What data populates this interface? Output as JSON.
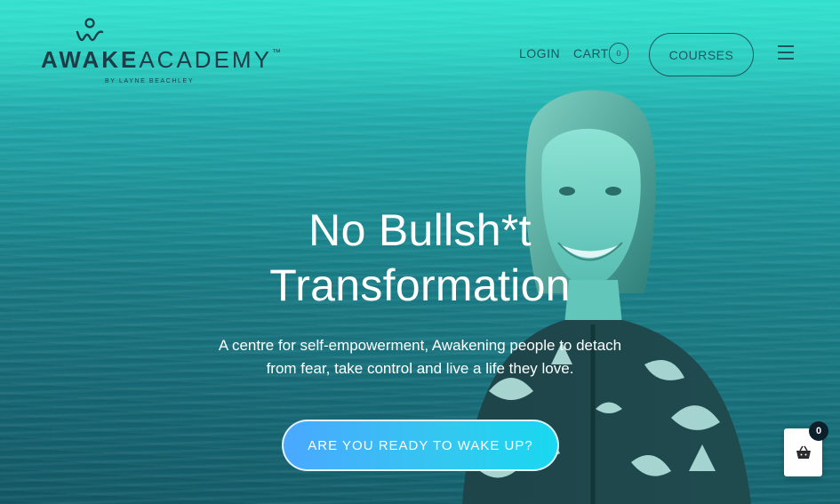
{
  "logo": {
    "word_bold": "AWAKE",
    "word_light": "ACADEMY",
    "tm": "™",
    "sub": "BY LAYNE BEACHLEY"
  },
  "nav": {
    "login": "LOGIN",
    "cart": "CART",
    "cart_count": "0",
    "courses": "COURSES"
  },
  "hero": {
    "title_line1": "No Bullsh*t",
    "title_line2": "Transformation",
    "subtitle_line1": "A centre for self-empowerment, Awakening people to detach",
    "subtitle_line2": "from fear, take control and live a life they love.",
    "cta": "ARE YOU READY TO WAKE UP?"
  },
  "basket": {
    "count": "0",
    "icon": "basket-icon"
  },
  "colors": {
    "accent": "#38e3cf",
    "cta_start": "#4aa8ff",
    "cta_end": "#19d8f0",
    "nav_text": "#1c3f49"
  }
}
